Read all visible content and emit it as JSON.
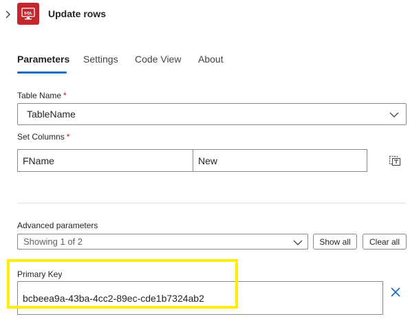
{
  "header": {
    "title": "Update rows",
    "sql_tile_text": "SQL"
  },
  "tabs": [
    {
      "label": "Parameters",
      "active": true
    },
    {
      "label": "Settings",
      "active": false
    },
    {
      "label": "Code View",
      "active": false
    },
    {
      "label": "About",
      "active": false
    }
  ],
  "table_name": {
    "label": "Table Name",
    "required_mark": "*",
    "value": "TableName"
  },
  "set_columns": {
    "label": "Set Columns",
    "required_mark": "*",
    "key": "FName",
    "value": "New"
  },
  "advanced": {
    "label": "Advanced parameters",
    "dropdown_value": "Showing 1 of 2",
    "show_all_label": "Show all",
    "clear_all_label": "Clear all"
  },
  "primary_key": {
    "label": "Primary Key",
    "value": "bcbeea9a-43ba-4cc2-89ec-cde1b7324ab2"
  },
  "colors": {
    "accent": "#0f6cbd",
    "sql_tile": "#c4262e",
    "highlight": "#ffee00",
    "required": "#c50f1f"
  },
  "icons": {
    "expand": "chevron-right-icon",
    "dropdown": "chevron-down-icon",
    "switch_mode": "table-switch-icon",
    "remove": "close-icon"
  }
}
